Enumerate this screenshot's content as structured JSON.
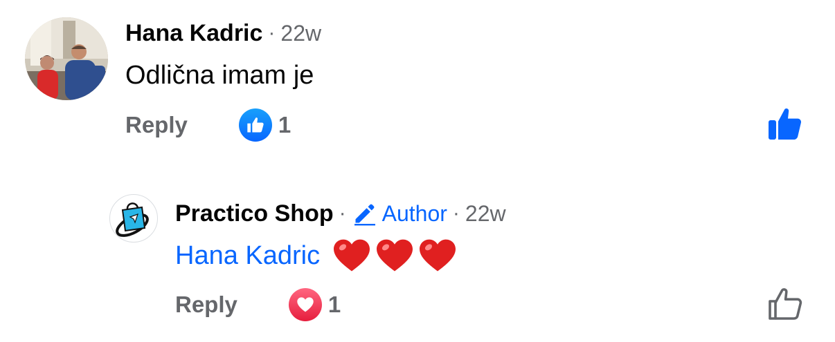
{
  "comment": {
    "author": "Hana Kadric",
    "separator": "·",
    "time": "22w",
    "text": "Odlična imam je",
    "actions": {
      "reply_label": "Reply",
      "reaction_count": "1"
    },
    "reaction_type": "like-icon"
  },
  "reply": {
    "author": "Practico Shop",
    "separator": "·",
    "author_badge": "Author",
    "separator2": "·",
    "time": "22w",
    "mention": "Hana Kadric",
    "emoji": [
      "❤️",
      "❤️",
      "❤️"
    ],
    "actions": {
      "reply_label": "Reply",
      "reaction_count": "1"
    },
    "reaction_type": "love-icon"
  },
  "colors": {
    "primary_text": "#050505",
    "secondary_text": "#65676b",
    "link_blue": "#0866ff",
    "like_blue": "#0866ff",
    "love_red": "#e61e3d",
    "heart_red": "#e02020"
  }
}
